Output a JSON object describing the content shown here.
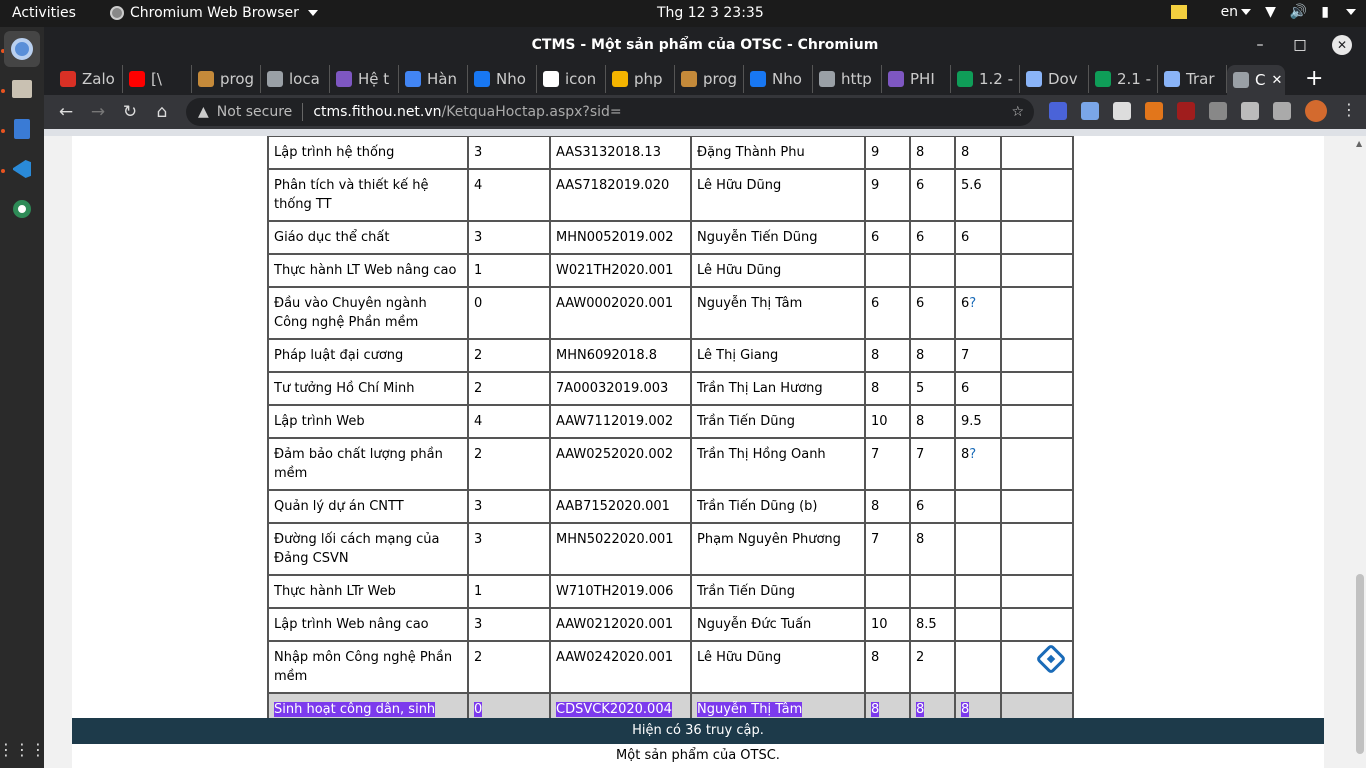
{
  "topbar": {
    "activities": "Activities",
    "app_name": "Chromium Web Browser",
    "clock": "Thg 12 3  23:35",
    "lang": "en"
  },
  "window": {
    "title": "CTMS - Một sản phẩm của OTSC - Chromium"
  },
  "tabs": [
    {
      "label": "Zalo",
      "color": "#d93025"
    },
    {
      "label": "[\\",
      "color": "#ff0000"
    },
    {
      "label": "prog",
      "color": "#c58a3a"
    },
    {
      "label": "loca",
      "color": "#9aa0a6"
    },
    {
      "label": "Hệ t",
      "color": "#7e57c2"
    },
    {
      "label": "Hàn",
      "color": "#4285f4"
    },
    {
      "label": "Nho",
      "color": "#1877f2"
    },
    {
      "label": "icon",
      "color": "#ffffff"
    },
    {
      "label": "php",
      "color": "#f4b400"
    },
    {
      "label": "prog",
      "color": "#c58a3a"
    },
    {
      "label": "Nho",
      "color": "#1877f2"
    },
    {
      "label": "http",
      "color": "#9aa0a6"
    },
    {
      "label": "PHI",
      "color": "#7e57c2"
    },
    {
      "label": "1.2 -",
      "color": "#0f9d58"
    },
    {
      "label": "Dov",
      "color": "#8ab4f8"
    },
    {
      "label": "2.1 -",
      "color": "#0f9d58"
    },
    {
      "label": "Trar",
      "color": "#8ab4f8"
    },
    {
      "label": "C",
      "color": "#9aa0a6",
      "active": true
    }
  ],
  "address": {
    "security": "Not secure",
    "host": "ctms.fithou.net.vn",
    "path": "/KetquaHoctap.aspx?sid="
  },
  "grades": {
    "rows": [
      {
        "subject": "Lập trình hệ thống",
        "credits": "3",
        "class_code": "AAS3132018.13",
        "lecturer": "Đặng Thành Phu",
        "s1": "9",
        "s2": "8",
        "s3": "8",
        "s3q": ""
      },
      {
        "subject": "Phân tích và thiết kế hệ thống TT",
        "credits": "4",
        "class_code": "AAS7182019.020",
        "lecturer": "Lê Hữu Dũng",
        "s1": "9",
        "s2": "6",
        "s3": "5.6",
        "s3q": ""
      },
      {
        "subject": "Giáo dục thể chất",
        "credits": "3",
        "class_code": "MHN0052019.002",
        "lecturer": "Nguyễn Tiến Dũng",
        "s1": "6",
        "s2": "6",
        "s3": "6",
        "s3q": ""
      },
      {
        "subject": "Thực hành LT Web nâng cao",
        "credits": "1",
        "class_code": "W021TH2020.001",
        "lecturer": "Lê Hữu Dũng",
        "s1": "",
        "s2": "",
        "s3": "",
        "s3q": ""
      },
      {
        "subject": "Đầu vào Chuyên ngành Công nghệ Phần mềm",
        "credits": "0",
        "class_code": "AAW0002020.001",
        "lecturer": "Nguyễn Thị Tâm",
        "s1": "6",
        "s2": "6",
        "s3": "6",
        "s3q": "?"
      },
      {
        "subject": "Pháp luật đại cương",
        "credits": "2",
        "class_code": "MHN6092018.8",
        "lecturer": "Lê Thị Giang",
        "s1": "8",
        "s2": "8",
        "s3": "7",
        "s3q": ""
      },
      {
        "subject": "Tư tưởng Hồ Chí Minh",
        "credits": "2",
        "class_code": "7A00032019.003",
        "lecturer": "Trần Thị Lan Hương",
        "s1": "8",
        "s2": "5",
        "s3": "6",
        "s3q": ""
      },
      {
        "subject": "Lập trình Web",
        "credits": "4",
        "class_code": "AAW7112019.002",
        "lecturer": "Trần Tiến Dũng",
        "s1": "10",
        "s2": "8",
        "s3": "9.5",
        "s3q": ""
      },
      {
        "subject": "Đảm bảo chất lượng phần mềm",
        "credits": "2",
        "class_code": "AAW0252020.002",
        "lecturer": "Trần Thị Hồng Oanh",
        "s1": "7",
        "s2": "7",
        "s3": "8",
        "s3q": "?"
      },
      {
        "subject": "Quản lý dự án CNTT",
        "credits": "3",
        "class_code": "AAB7152020.001",
        "lecturer": "Trần Tiến Dũng (b)",
        "s1": "8",
        "s2": "6",
        "s3": "",
        "s3q": ""
      },
      {
        "subject": "Đường lối cách mạng của Đảng CSVN",
        "credits": "3",
        "class_code": "MHN5022020.001",
        "lecturer": "Phạm Nguyên Phương",
        "s1": "7",
        "s2": "8",
        "s3": "",
        "s3q": ""
      },
      {
        "subject": "Thực hành LTr Web",
        "credits": "1",
        "class_code": "W710TH2019.006",
        "lecturer": "Trần Tiến Dũng",
        "s1": "",
        "s2": "",
        "s3": "",
        "s3q": ""
      },
      {
        "subject": "Lập trình Web nâng cao",
        "credits": "3",
        "class_code": "AAW0212020.001",
        "lecturer": "Nguyễn Đức Tuấn",
        "s1": "10",
        "s2": "8.5",
        "s3": "",
        "s3q": ""
      },
      {
        "subject": "Nhập môn Công nghệ Phần mềm",
        "credits": "2",
        "class_code": "AAW0242020.001",
        "lecturer": "Lê Hữu Dũng",
        "s1": "8",
        "s2": "2",
        "s3": "",
        "s3q": "",
        "edit": true
      },
      {
        "subject": "Sinh hoạt công dân, sinh viên cuối khóa",
        "credits": "0",
        "class_code": "CDSVCK2020.004",
        "lecturer": "Nguyễn Thị Tâm",
        "s1": "8",
        "s2": "8",
        "s3": "8",
        "s3q": "",
        "selected": true
      }
    ]
  },
  "footer": {
    "visitors": "Hiện có 36 truy cập.",
    "credit": "Một sản phẩm của OTSC."
  }
}
